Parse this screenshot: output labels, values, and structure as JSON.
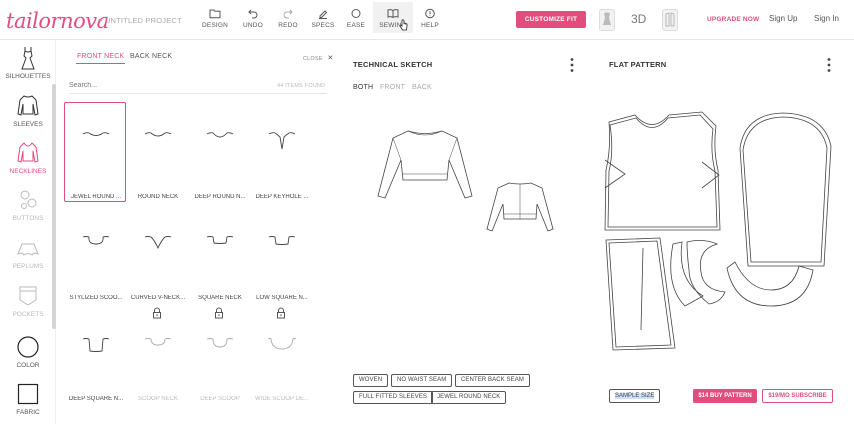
{
  "header": {
    "logo": "tailornova",
    "project": "> UNTITLED PROJECT",
    "tools": [
      {
        "label": "DESIGN",
        "icon": "folder-icon"
      },
      {
        "label": "UNDO",
        "icon": "undo-icon"
      },
      {
        "label": "REDO",
        "icon": "redo-icon"
      },
      {
        "label": "SPECS",
        "icon": "pencil-icon"
      },
      {
        "label": "EASE",
        "icon": "circle-icon"
      },
      {
        "label": "SEWING",
        "icon": "book-icon"
      },
      {
        "label": "HELP",
        "icon": "help-icon"
      }
    ],
    "customize_fit": "CUSTOMIZE FIT",
    "mode_3d": "3D",
    "upgrade": "UPGRADE NOW",
    "sign_up": "Sign Up",
    "sign_in": "Sign In"
  },
  "sidebar": {
    "items": [
      {
        "label": "SILHOUETTES",
        "icon": "dress-icon",
        "state": "normal"
      },
      {
        "label": "SLEEVES",
        "icon": "sleeve-icon",
        "state": "normal"
      },
      {
        "label": "NECKLINES",
        "icon": "neckline-icon",
        "state": "active"
      },
      {
        "label": "BUTTONS",
        "icon": "buttons-icon",
        "state": "disabled"
      },
      {
        "label": "PEPLUMS",
        "icon": "peplum-icon",
        "state": "disabled"
      },
      {
        "label": "POCKETS",
        "icon": "pocket-icon",
        "state": "disabled"
      },
      {
        "label": "COLOR",
        "icon": "color-circle-icon",
        "state": "normal"
      },
      {
        "label": "FABRIC",
        "icon": "fabric-square-icon",
        "state": "normal"
      }
    ]
  },
  "options_panel": {
    "tabs": {
      "front": "FRONT NECK",
      "back": "BACK NECK"
    },
    "close": "CLOSE",
    "search_placeholder": "Search...",
    "count": "44 ITEMS FOUND",
    "items": [
      {
        "name": "JEWEL ROUND ...",
        "selected": true,
        "locked": false
      },
      {
        "name": "ROUND NECK",
        "selected": false,
        "locked": false
      },
      {
        "name": "DEEP ROUND N...",
        "selected": false,
        "locked": false
      },
      {
        "name": "DEEP KEYHOLE ...",
        "selected": false,
        "locked": false
      },
      {
        "name": "STYLIZED SCOO...",
        "selected": false,
        "locked": false
      },
      {
        "name": "CURVED V-NECK...",
        "selected": false,
        "locked": true
      },
      {
        "name": "SQUARE NECK",
        "selected": false,
        "locked": true
      },
      {
        "name": "LOW SQUARE N...",
        "selected": false,
        "locked": true
      },
      {
        "name": "DEEP SQUARE N...",
        "selected": false,
        "locked": false
      },
      {
        "name": "SCOOP NECK",
        "selected": false,
        "locked": false
      },
      {
        "name": "DEEP SCOOP",
        "selected": false,
        "locked": false
      },
      {
        "name": "WIDE SCOOP DE...",
        "selected": false,
        "locked": false
      }
    ]
  },
  "technical_sketch": {
    "title": "TECHNICAL SKETCH",
    "views": [
      "BOTH",
      "FRONT",
      "BACK"
    ],
    "active_view": "BOTH"
  },
  "flat_pattern": {
    "title": "FLAT PATTERN"
  },
  "design_tags": [
    "WOVEN",
    "NO WAIST SEAM",
    "CENTER BACK SEAM",
    "FULL FITTED SLEEVES",
    "JEWEL ROUND NECK"
  ],
  "actions": {
    "sample_size": "SAMPLE SIZE",
    "buy": "$14 BUY PATTERN",
    "subscribe": "$19/MO SUBSCRIBE"
  },
  "colors": {
    "brand": "#e24d7e",
    "text": "#333333",
    "muted": "#aaaaaa"
  }
}
